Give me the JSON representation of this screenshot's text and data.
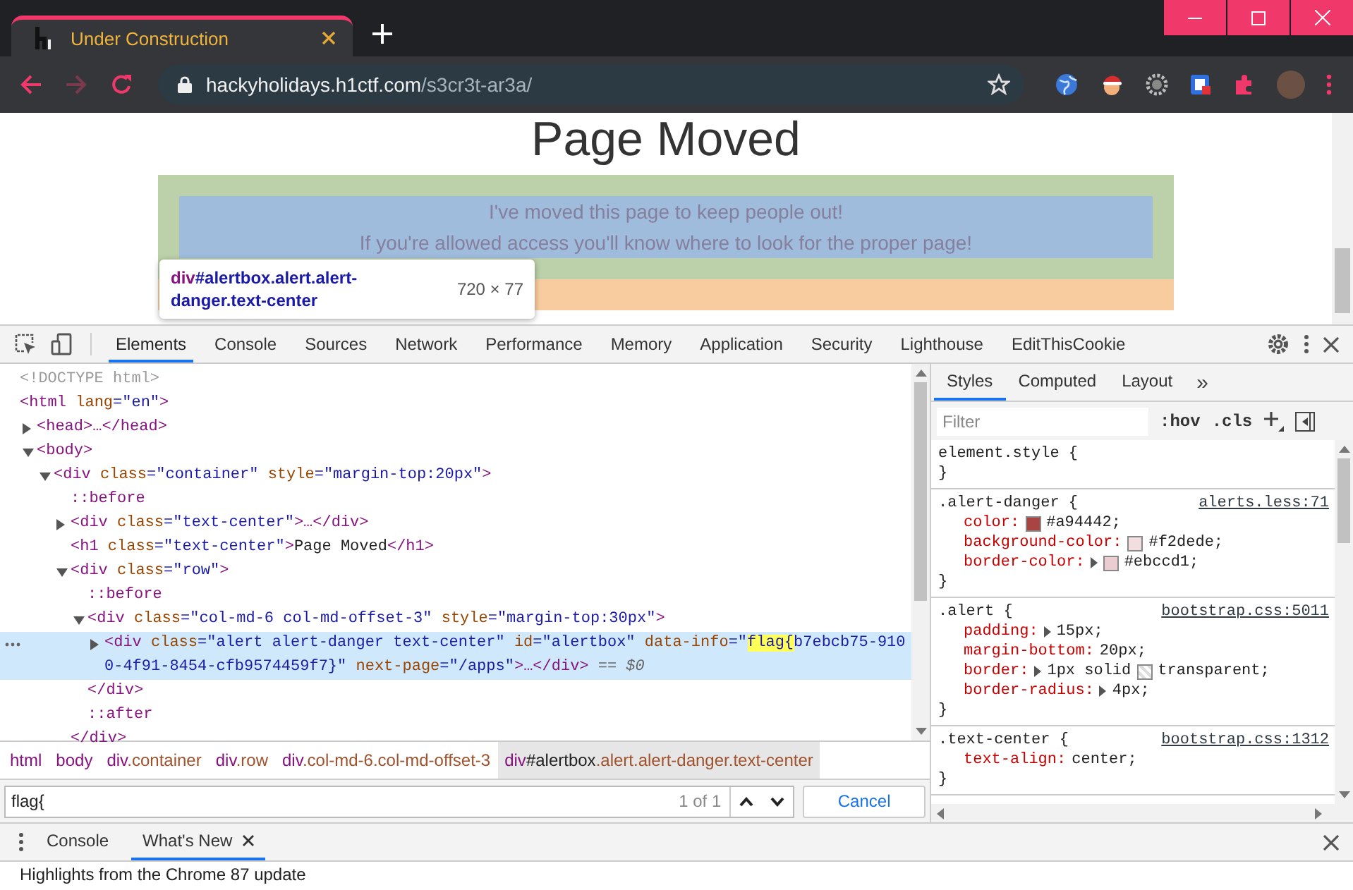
{
  "browser": {
    "tab": {
      "title": "Under Construction"
    },
    "nav_buttons": [
      {
        "kind": "back",
        "disabled": false
      },
      {
        "kind": "forward",
        "disabled": true
      },
      {
        "kind": "reload",
        "disabled": false
      }
    ],
    "address": {
      "host": "hackyholidays.h1ctf.com",
      "path": "/s3cr3t-ar3a/"
    }
  },
  "page": {
    "heading": "Page Moved",
    "alert_lines": [
      "I've moved this page to keep people out!",
      "If you're allowed access you'll know where to look for the proper page!"
    ],
    "tooltip": {
      "tag": "div",
      "selector": "#alertbox.alert.alert-danger.text-center",
      "size": "720 × 77"
    }
  },
  "devtools": {
    "tabs": [
      {
        "label": "Elements",
        "selected": true
      },
      {
        "label": "Console",
        "selected": false
      },
      {
        "label": "Sources",
        "selected": false
      },
      {
        "label": "Network",
        "selected": false
      },
      {
        "label": "Performance",
        "selected": false
      },
      {
        "label": "Memory",
        "selected": false
      },
      {
        "label": "Application",
        "selected": false
      },
      {
        "label": "Security",
        "selected": false
      },
      {
        "label": "Lighthouse",
        "selected": false
      },
      {
        "label": "EditThisCookie",
        "selected": false
      }
    ],
    "elements": {
      "tree": [
        {
          "selected": false,
          "parts": [
            {
              "kind": "dim",
              "s": "<!DOCTYPE html>"
            }
          ]
        },
        {
          "selected": false,
          "parts": [
            {
              "kind": "tag",
              "s": "<html"
            },
            {
              "kind": "attr",
              "s": " lang"
            },
            {
              "kind": "val",
              "s": "=\"en\""
            },
            {
              "kind": "tag",
              "s": ">"
            }
          ],
          "children": [
            {
              "expanded": false,
              "selected": false,
              "parts": [
                {
                  "kind": "tag",
                  "s": "<head>…</head>"
                }
              ]
            },
            {
              "expanded": true,
              "selected": false,
              "parts": [
                {
                  "kind": "tag",
                  "s": "<body>"
                }
              ],
              "children": [
                {
                  "expanded": true,
                  "selected": false,
                  "parts": [
                    {
                      "kind": "tag",
                      "s": "<div"
                    },
                    {
                      "kind": "attr",
                      "s": " class"
                    },
                    {
                      "kind": "val",
                      "s": "=\"container\""
                    },
                    {
                      "kind": "attr",
                      "s": " style"
                    },
                    {
                      "kind": "val",
                      "s": "=\"margin-top:20px\""
                    },
                    {
                      "kind": "tag",
                      "s": ">"
                    }
                  ],
                  "children": [
                    {
                      "selected": false,
                      "parts": [
                        {
                          "kind": "tag",
                          "s": "::before"
                        }
                      ]
                    },
                    {
                      "expanded": false,
                      "selected": false,
                      "parts": [
                        {
                          "kind": "tag",
                          "s": "<div"
                        },
                        {
                          "kind": "attr",
                          "s": " class"
                        },
                        {
                          "kind": "val",
                          "s": "=\"text-center\""
                        },
                        {
                          "kind": "tag",
                          "s": ">…</div>"
                        }
                      ]
                    },
                    {
                      "selected": false,
                      "parts": [
                        {
                          "kind": "tag",
                          "s": "<h1"
                        },
                        {
                          "kind": "attr",
                          "s": " class"
                        },
                        {
                          "kind": "val",
                          "s": "=\"text-center\""
                        },
                        {
                          "kind": "tag",
                          "s": ">"
                        },
                        {
                          "kind": "text",
                          "s": "Page Moved"
                        },
                        {
                          "kind": "tag",
                          "s": "</h1>"
                        }
                      ]
                    },
                    {
                      "expanded": true,
                      "selected": false,
                      "parts": [
                        {
                          "kind": "tag",
                          "s": "<div"
                        },
                        {
                          "kind": "attr",
                          "s": " class"
                        },
                        {
                          "kind": "val",
                          "s": "=\"row\""
                        },
                        {
                          "kind": "tag",
                          "s": ">"
                        }
                      ],
                      "children": [
                        {
                          "selected": false,
                          "parts": [
                            {
                              "kind": "tag",
                              "s": "::before"
                            }
                          ]
                        },
                        {
                          "expanded": true,
                          "selected": false,
                          "parts": [
                            {
                              "kind": "tag",
                              "s": "<div"
                            },
                            {
                              "kind": "attr",
                              "s": " class"
                            },
                            {
                              "kind": "val",
                              "s": "=\"col-md-6 col-md-offset-3\""
                            },
                            {
                              "kind": "attr",
                              "s": " style"
                            },
                            {
                              "kind": "val",
                              "s": "=\"margin-top:30px\""
                            },
                            {
                              "kind": "tag",
                              "s": ">"
                            }
                          ],
                          "children": [
                            {
                              "expanded": false,
                              "selected": true,
                              "parts": [
                                {
                                  "kind": "tag",
                                  "s": "<div"
                                },
                                {
                                  "kind": "attr",
                                  "s": " class"
                                },
                                {
                                  "kind": "val",
                                  "s": "=\"alert alert-danger text-center\""
                                },
                                {
                                  "kind": "attr",
                                  "s": " id"
                                },
                                {
                                  "kind": "val",
                                  "s": "=\"alertbox\""
                                },
                                {
                                  "kind": "attr",
                                  "s": " data-info"
                                },
                                {
                                  "kind": "val",
                                  "s": "=\""
                                },
                                {
                                  "kind": "match",
                                  "s": "flag{"
                                },
                                {
                                  "kind": "val",
                                  "s": "b7ebcb75-9100-4f91-8454-cfb9574459f7}\""
                                },
                                {
                                  "kind": "attr",
                                  "s": " next-page"
                                },
                                {
                                  "kind": "val",
                                  "s": "=\"/apps\""
                                },
                                {
                                  "kind": "tag",
                                  "s": ">…</div>"
                                },
                                {
                                  "kind": "ref",
                                  "s": " == $0"
                                }
                              ]
                            }
                          ],
                          "close": [
                            {
                              "kind": "tag",
                              "s": "</div>"
                            }
                          ]
                        },
                        {
                          "selected": false,
                          "parts": [
                            {
                              "kind": "tag",
                              "s": "::after"
                            }
                          ]
                        }
                      ],
                      "close": [
                        {
                          "kind": "tag",
                          "s": "</div>"
                        }
                      ]
                    }
                  ]
                }
              ]
            }
          ]
        }
      ]
    },
    "breadcrumbs": [
      {
        "parts": [
          {
            "kind": "tag",
            "s": "html"
          }
        ],
        "selected": false
      },
      {
        "parts": [
          {
            "kind": "tag",
            "s": "body"
          }
        ],
        "selected": false
      },
      {
        "parts": [
          {
            "kind": "tag",
            "s": "div"
          },
          {
            "kind": "cls",
            "s": ".container"
          }
        ],
        "selected": false
      },
      {
        "parts": [
          {
            "kind": "tag",
            "s": "div"
          },
          {
            "kind": "cls",
            "s": ".row"
          }
        ],
        "selected": false
      },
      {
        "parts": [
          {
            "kind": "tag",
            "s": "div"
          },
          {
            "kind": "cls",
            "s": ".col-md-6.col-md-offset-3"
          }
        ],
        "selected": false
      },
      {
        "parts": [
          {
            "kind": "tag",
            "s": "div"
          },
          {
            "kind": "id",
            "s": "#alertbox"
          },
          {
            "kind": "cls",
            "s": ".alert.alert-danger.text-center"
          }
        ],
        "selected": true
      }
    ],
    "search": {
      "value": "flag{",
      "count": "1 of 1",
      "cancel": "Cancel"
    },
    "styles": {
      "tabs": [
        {
          "label": "Styles",
          "selected": true
        },
        {
          "label": "Computed",
          "selected": false
        },
        {
          "label": "Layout",
          "selected": false
        }
      ],
      "more": "»",
      "filter_placeholder": "Filter",
      "hov": ":hov",
      "cls": ".cls",
      "rules": [
        {
          "selector": "element.style {",
          "close": "}"
        },
        {
          "selector": ".alert-danger {",
          "source": "alerts.less:71",
          "close": "}",
          "props": [
            {
              "name": "color:",
              "value": "#a94442;",
              "kind": "color",
              "color": "#a94442",
              "expandable": false
            },
            {
              "name": "background-color:",
              "value": "#f2dede;",
              "kind": "color",
              "color": "#f2dede",
              "expandable": false
            },
            {
              "name": "border-color:",
              "value": "#ebccd1;",
              "kind": "color",
              "color": "#ebccd1",
              "expandable": true
            }
          ]
        },
        {
          "selector": ".alert {",
          "source": "bootstrap.css:5011",
          "close": "}",
          "props": [
            {
              "name": "padding:",
              "value": "15px;",
              "kind": "plain",
              "expandable": true
            },
            {
              "name": "margin-bottom:",
              "value": "20px;",
              "kind": "plain",
              "expandable": false
            },
            {
              "name": "border:",
              "prefix": "1px solid",
              "value": "transparent;",
              "kind": "transparent",
              "expandable": true
            },
            {
              "name": "border-radius:",
              "value": "4px;",
              "kind": "plain",
              "expandable": true
            }
          ]
        },
        {
          "selector": ".text-center {",
          "source": "bootstrap.css:1312",
          "close": "}",
          "props": [
            {
              "name": "text-align:",
              "value": "center;",
              "kind": "plain",
              "expandable": false
            }
          ]
        }
      ]
    },
    "drawer": {
      "tabs": [
        {
          "label": "Console",
          "selected": false,
          "closable": false
        },
        {
          "label": "What's New",
          "selected": true,
          "closable": true
        }
      ],
      "text": "Highlights from the Chrome 87 update"
    }
  }
}
